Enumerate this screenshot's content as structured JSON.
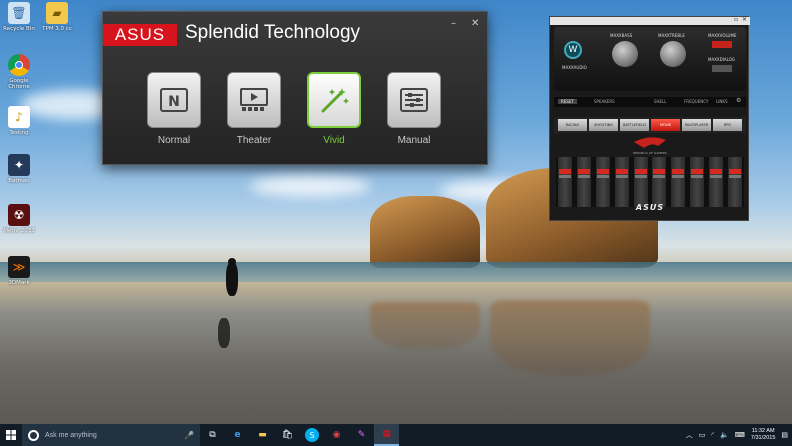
{
  "desktop": {
    "icons": [
      {
        "label": "Recycle Bin",
        "icon": "recycle-bin-icon"
      },
      {
        "label": "Google Chrome",
        "icon": "chrome-icon"
      },
      {
        "label": "Testing",
        "icon": "document-icon"
      },
      {
        "label": "Batman",
        "icon": "game-icon"
      },
      {
        "label": "Metro 2033",
        "icon": "game-icon"
      },
      {
        "label": "3DMark",
        "icon": "benchmark-icon"
      }
    ],
    "folder_icon": {
      "label": "TPM 3.0 cc"
    }
  },
  "splendid": {
    "brand": "ASUS",
    "title": "Splendid Technology",
    "minimize": "–",
    "close": "✕",
    "modes": [
      {
        "label": "Normal",
        "icon": "normal-mode-icon",
        "active": false
      },
      {
        "label": "Theater",
        "icon": "theater-mode-icon",
        "active": false
      },
      {
        "label": "Vivid",
        "icon": "vivid-mode-icon",
        "active": true
      },
      {
        "label": "Manual",
        "icon": "manual-mode-icon",
        "active": false
      }
    ],
    "accent": "#7ccf3c",
    "brand_color": "#d7141d"
  },
  "audio": {
    "logo_text": "MAXXAUDIO",
    "knob_labels": [
      "MAXXBASS",
      "MAXXTREBLE",
      "MAXXVOLUME"
    ],
    "knob_sub": "MAXXDIALOG",
    "reset": "RESET",
    "output": "SPEAKERS",
    "tabs": [
      "SHELL",
      "FREQUENCY",
      "LINKS"
    ],
    "presets": [
      {
        "label": "RACING",
        "on": false
      },
      {
        "label": "SHOOTING",
        "on": false
      },
      {
        "label": "BATTLEFIELD",
        "on": false
      },
      {
        "label": "MOVIE",
        "on": true
      },
      {
        "label": "MULTIPLAYER",
        "on": false
      },
      {
        "label": "RPG",
        "on": false
      }
    ],
    "brand": "ASUS",
    "rog_tagline": "REPUBLIC OF GAMERS"
  },
  "taskbar": {
    "search_placeholder": "Ask me anything",
    "apps": [
      {
        "name": "task-view",
        "glyph": "⧉"
      },
      {
        "name": "edge",
        "glyph": "e"
      },
      {
        "name": "file-explorer",
        "glyph": "▬"
      },
      {
        "name": "store",
        "glyph": "🛍"
      },
      {
        "name": "skype",
        "glyph": "S"
      },
      {
        "name": "chrome",
        "glyph": "◉"
      },
      {
        "name": "paint",
        "glyph": "✎"
      },
      {
        "name": "splendid",
        "glyph": "▦"
      }
    ],
    "time": "11:32 AM",
    "date": "7/31/2015"
  }
}
